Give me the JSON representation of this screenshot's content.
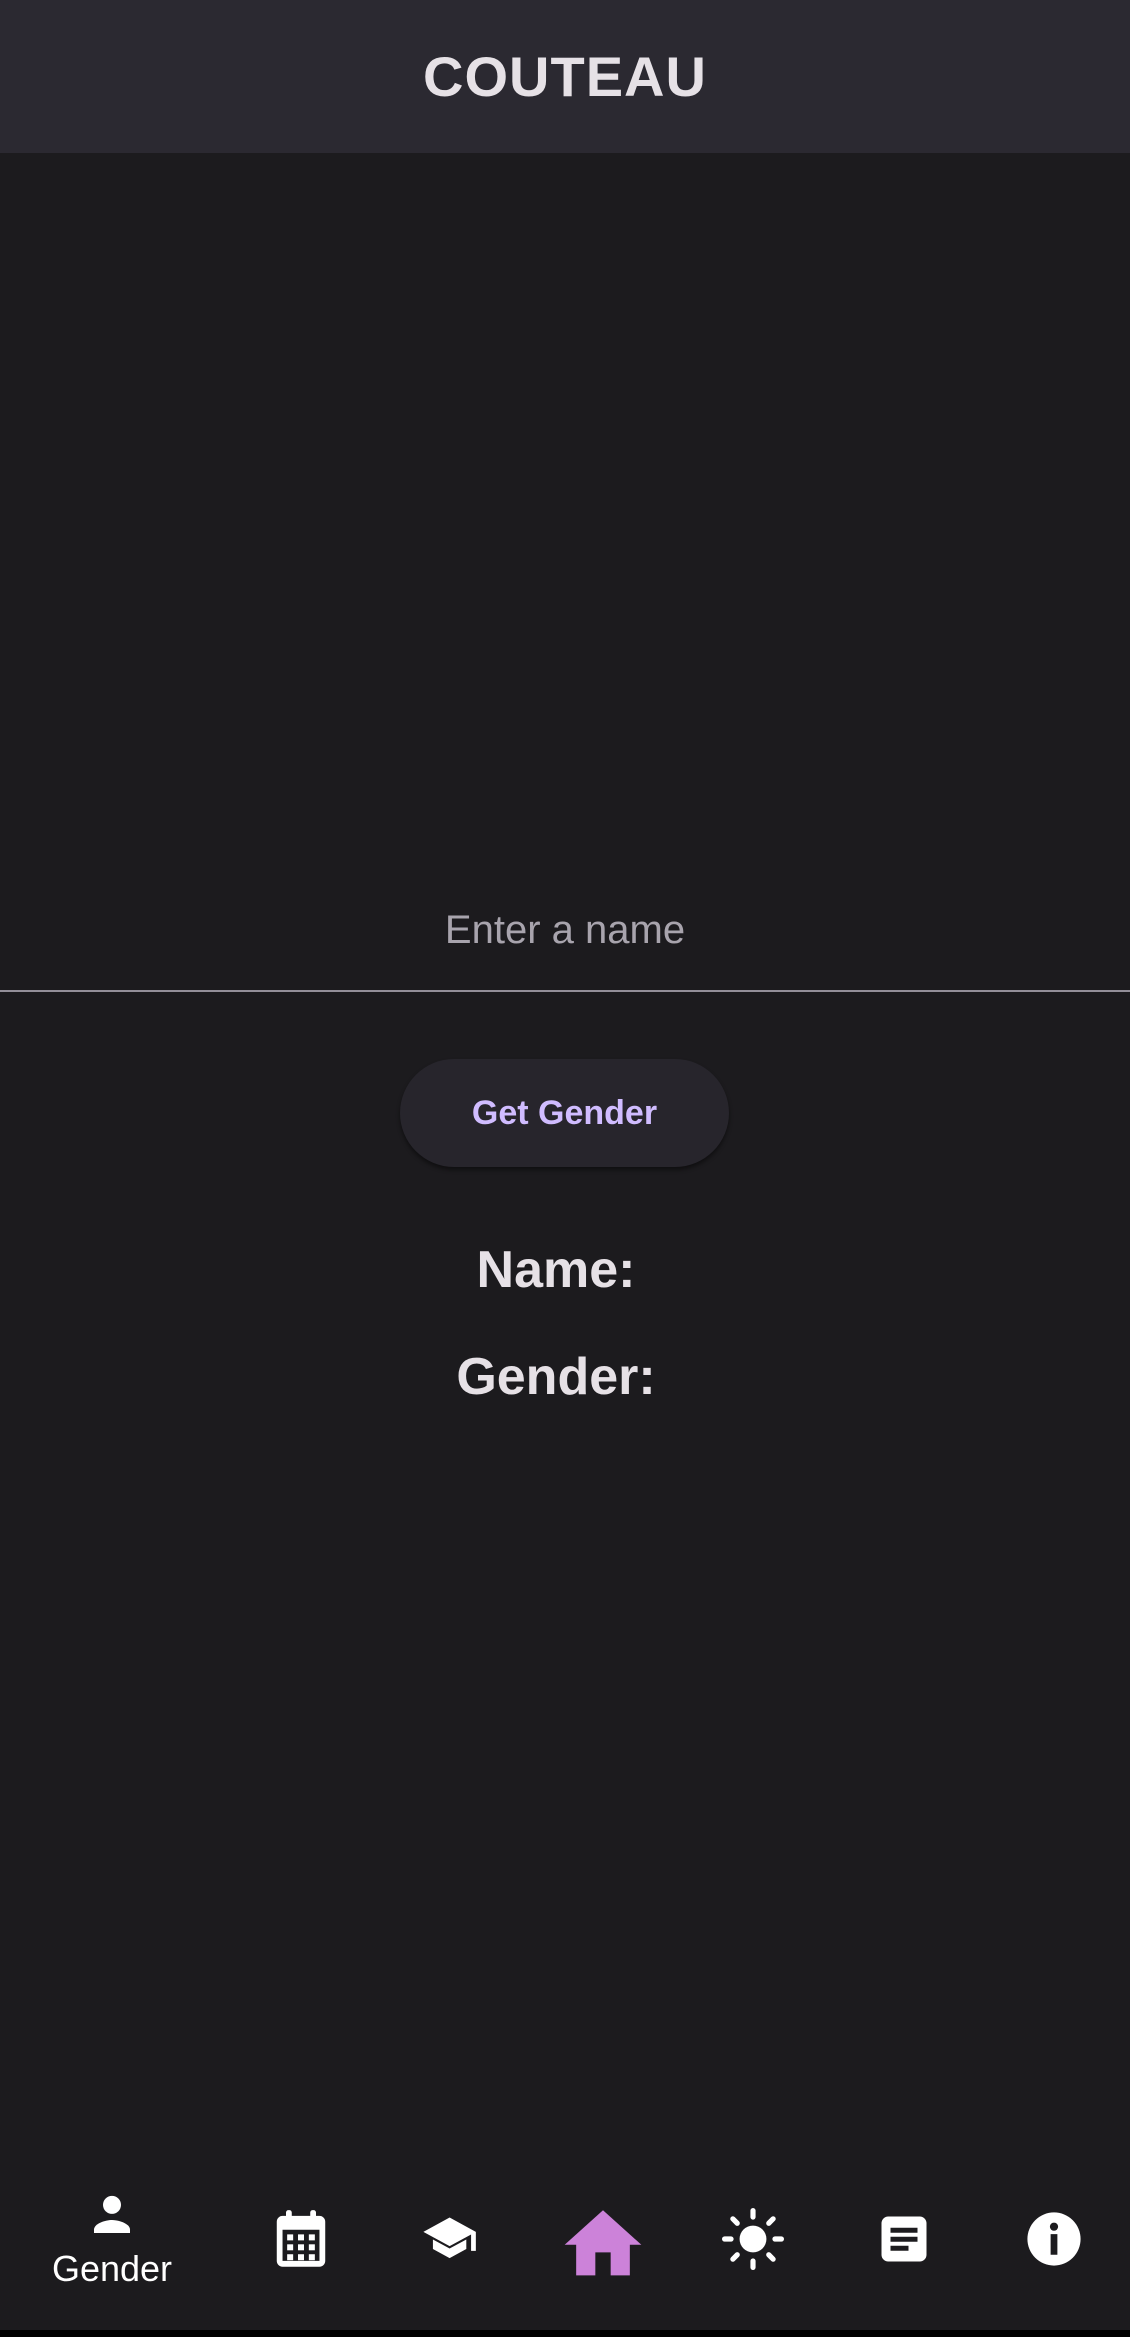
{
  "app_bar": {
    "title": "COUTEAU"
  },
  "form": {
    "name_input_value": "",
    "name_input_placeholder": "Enter a name",
    "submit_label": "Get Gender"
  },
  "results": {
    "name_label": "Name:",
    "gender_label": "Gender:"
  },
  "bottom_nav": {
    "items": [
      {
        "icon": "person-icon",
        "label": "Gender",
        "selected": true
      },
      {
        "icon": "calendar-icon",
        "label": ""
      },
      {
        "icon": "school-icon",
        "label": ""
      },
      {
        "icon": "home-icon",
        "label": ""
      },
      {
        "icon": "sun-icon",
        "label": ""
      },
      {
        "icon": "article-icon",
        "label": ""
      },
      {
        "icon": "info-icon",
        "label": ""
      }
    ]
  },
  "colors": {
    "background": "#1c1b1e",
    "app_bar": "#2b2931",
    "accent": "#d0bcff",
    "home_icon": "#cc82d9",
    "text": "#e6e1e6"
  }
}
